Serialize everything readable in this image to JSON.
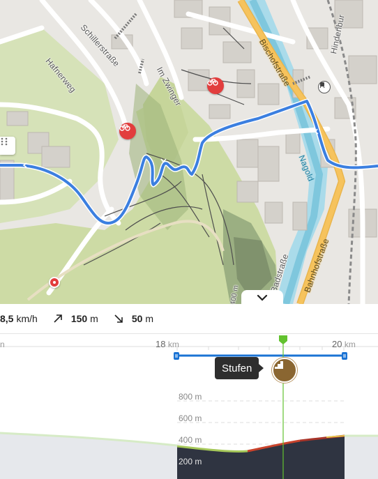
{
  "map": {
    "streets": {
      "schillerstrasse": "Schillerstraße",
      "hafnerweg": "Hafnerweg",
      "im_zwinger": "Im Zwinger",
      "bischofstrasse": "Bischofstraße",
      "hindenburg": "Hindenbur",
      "nagold": "Nagold",
      "badstrasse": "Badstraße",
      "bahnhofstrasse": "Bahnhofstraße",
      "edge_elevation": "400 m"
    },
    "pois": [
      "bike-shop",
      "bike-shop",
      "train-station",
      "location-pin"
    ]
  },
  "stats": {
    "speed_value": "8,5",
    "speed_unit": "km/h",
    "uphill_value": "150",
    "uphill_unit": "m",
    "downhill_value": "50",
    "downhill_unit": "m"
  },
  "elevation": {
    "axis_left_unit": "n",
    "axis_18_value": "18",
    "axis_18_unit": "km",
    "axis_20_value": "20",
    "axis_20_unit": "km",
    "alt_800": "800 m",
    "alt_600": "600 m",
    "alt_400": "400 m",
    "alt_200": "200 m",
    "tooltip": "Stufen",
    "colors": {
      "route": "#1a73d4",
      "marker": "#62c22e",
      "terrain": "#2f3441",
      "stairs": "#8a6631"
    }
  }
}
